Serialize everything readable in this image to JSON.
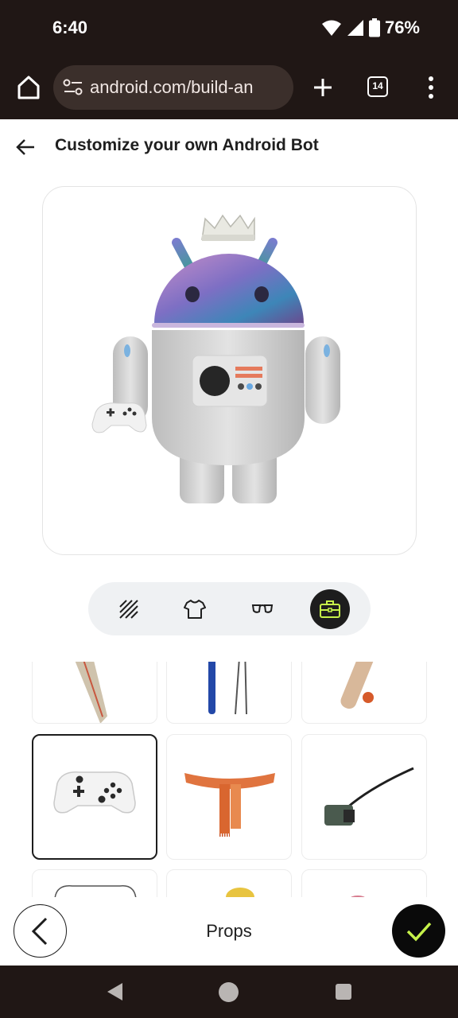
{
  "status_bar": {
    "time": "6:40",
    "battery": "76%"
  },
  "browser": {
    "url": "android.com/build-an",
    "tab_count": "14"
  },
  "header": {
    "title": "Customize your own Android Bot"
  },
  "categories": [
    {
      "name": "Pattern",
      "icon": "pattern-icon"
    },
    {
      "name": "Clothing",
      "icon": "shirt-icon"
    },
    {
      "name": "Accessories",
      "icon": "glasses-icon"
    },
    {
      "name": "Props",
      "icon": "briefcase-icon",
      "active": true
    }
  ],
  "grid": {
    "items": [
      {
        "name": "surfboard-prop",
        "selected": false
      },
      {
        "name": "ski-poles-prop",
        "selected": false
      },
      {
        "name": "cricket-bat-prop",
        "selected": false
      },
      {
        "name": "game-controller-prop",
        "selected": true
      },
      {
        "name": "scarf-prop",
        "selected": false
      },
      {
        "name": "camera-prop",
        "selected": false
      },
      {
        "name": "item-7",
        "selected": false
      },
      {
        "name": "item-8",
        "selected": false
      },
      {
        "name": "item-9",
        "selected": false
      }
    ]
  },
  "bottom_bar": {
    "label": "Props"
  },
  "colors": {
    "system_bar": "#201715",
    "url_box": "#3b2f2b",
    "accent_check": "#c6f24a",
    "active_category": "#1d1d1d"
  }
}
